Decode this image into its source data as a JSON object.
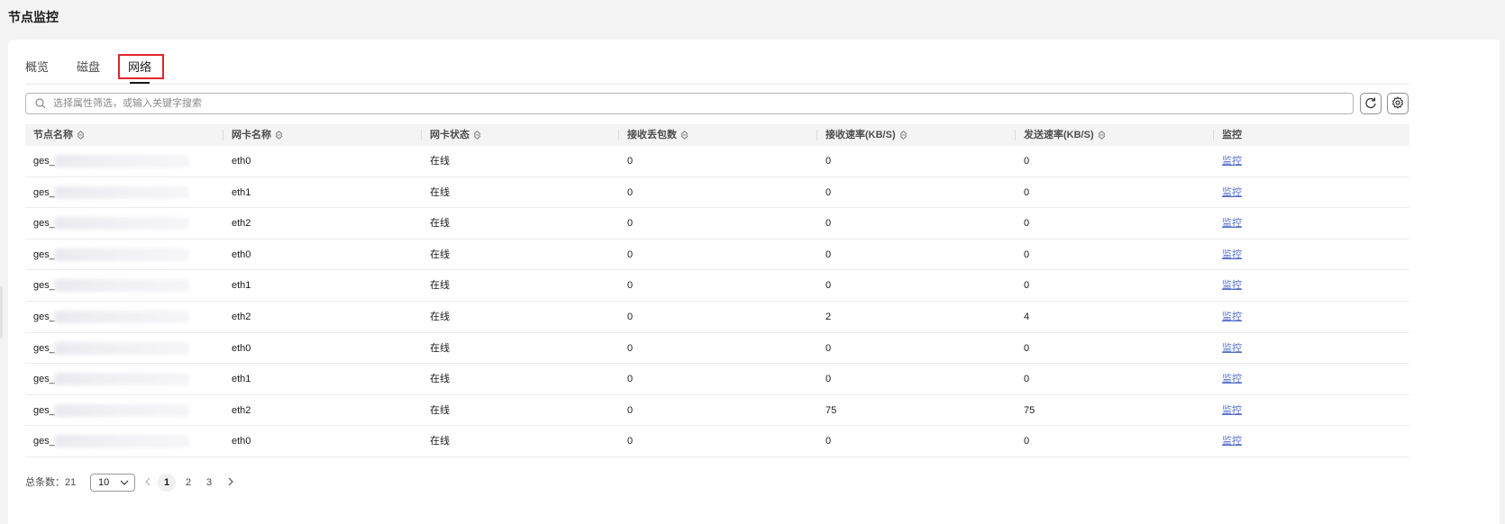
{
  "page": {
    "title": "节点监控"
  },
  "tabs": [
    {
      "label": "概览"
    },
    {
      "label": "磁盘"
    },
    {
      "label": "网络",
      "active": true
    }
  ],
  "search": {
    "placeholder": "选择属性筛选，或输入关键字搜索",
    "value": ""
  },
  "icons": {
    "refresh": "refresh-icon",
    "settings": "gear-icon",
    "search": "search-icon",
    "sort": "sort-icon"
  },
  "colors": {
    "link": "#526ecc",
    "highlight_box": "#e0262b",
    "header_bg": "#f4f4f4"
  },
  "table": {
    "columns": [
      "节点名称",
      "网卡名称",
      "网卡状态",
      "接收丢包数",
      "接收速率(KB/S)",
      "发送速率(KB/S)",
      "监控"
    ],
    "rows": [
      {
        "node": "ges_",
        "nic": "eth0",
        "status": "在线",
        "drop": "0",
        "rx": "0",
        "tx": "0",
        "action": "监控"
      },
      {
        "node": "ges_",
        "nic": "eth1",
        "status": "在线",
        "drop": "0",
        "rx": "0",
        "tx": "0",
        "action": "监控"
      },
      {
        "node": "ges_",
        "nic": "eth2",
        "status": "在线",
        "drop": "0",
        "rx": "0",
        "tx": "0",
        "action": "监控"
      },
      {
        "node": "ges_",
        "nic": "eth0",
        "status": "在线",
        "drop": "0",
        "rx": "0",
        "tx": "0",
        "action": "监控"
      },
      {
        "node": "ges_",
        "nic": "eth1",
        "status": "在线",
        "drop": "0",
        "rx": "0",
        "tx": "0",
        "action": "监控"
      },
      {
        "node": "ges_",
        "nic": "eth2",
        "status": "在线",
        "drop": "0",
        "rx": "2",
        "tx": "4",
        "action": "监控"
      },
      {
        "node": "ges_",
        "nic": "eth0",
        "status": "在线",
        "drop": "0",
        "rx": "0",
        "tx": "0",
        "action": "监控"
      },
      {
        "node": "ges_",
        "nic": "eth1",
        "status": "在线",
        "drop": "0",
        "rx": "0",
        "tx": "0",
        "action": "监控"
      },
      {
        "node": "ges_",
        "nic": "eth2",
        "status": "在线",
        "drop": "0",
        "rx": "75",
        "tx": "75",
        "action": "监控"
      },
      {
        "node": "ges_",
        "nic": "eth0",
        "status": "在线",
        "drop": "0",
        "rx": "0",
        "tx": "0",
        "action": "监控"
      }
    ]
  },
  "pagination": {
    "total_label": "总条数：21",
    "page_size": "10",
    "pages": [
      "1",
      "2",
      "3"
    ],
    "current": "1"
  }
}
